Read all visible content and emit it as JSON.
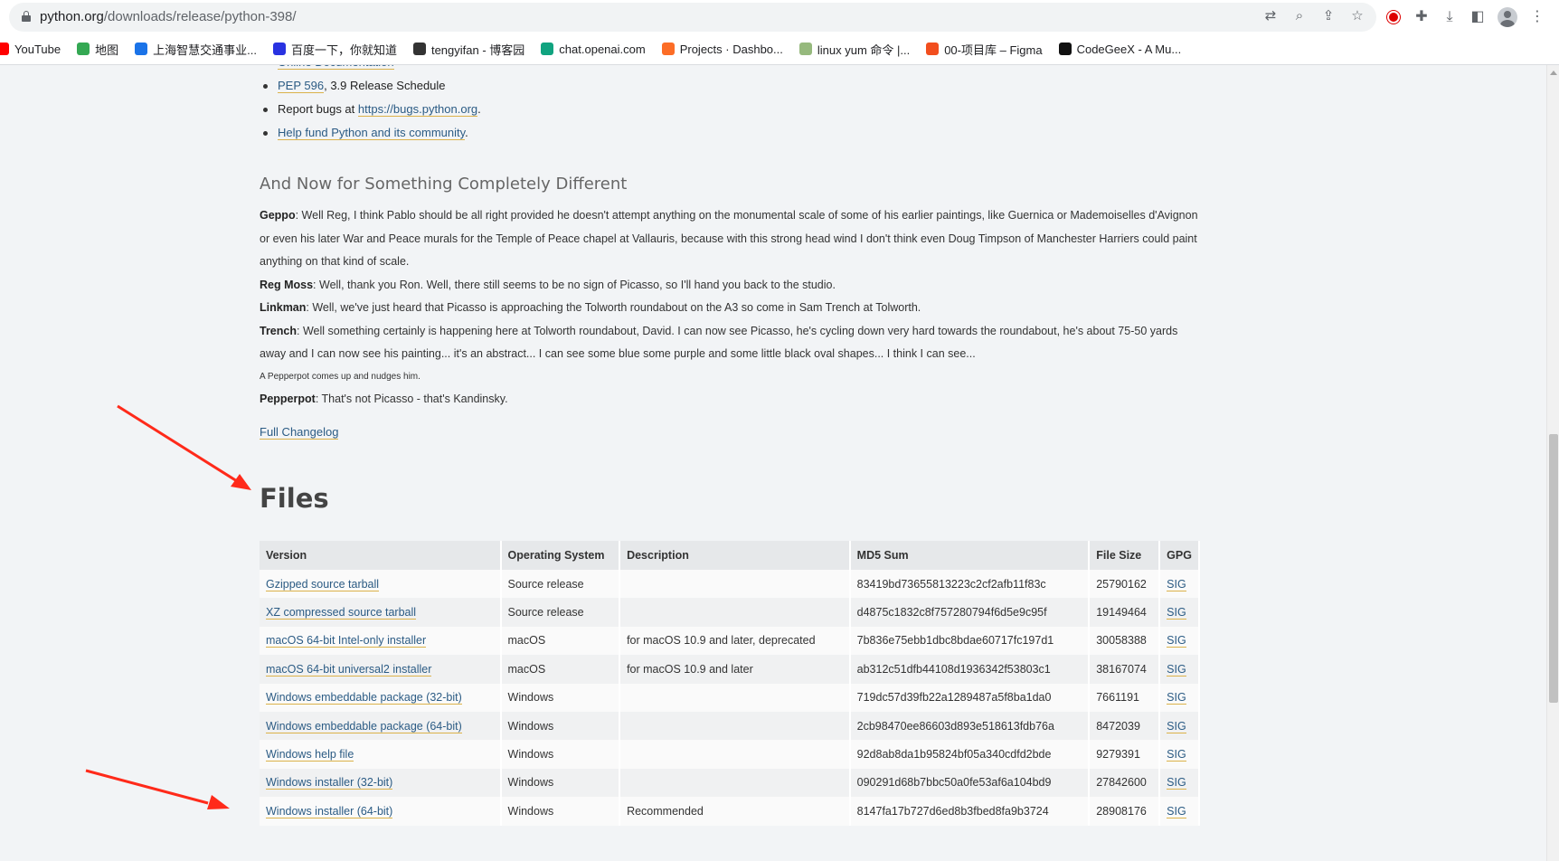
{
  "browser": {
    "url_host": "python.org",
    "url_path": "/downloads/release/python-398/",
    "bookmarks": [
      {
        "label": "YouTube",
        "icon": "youtube-icon",
        "color": "#ff0000"
      },
      {
        "label": "地图",
        "icon": "maps-icon",
        "color": "#34a853"
      },
      {
        "label": "上海智慧交通事业...",
        "icon": "bookmark-icon",
        "color": "#1a73e8"
      },
      {
        "label": "百度一下，你就知道",
        "icon": "baidu-icon",
        "color": "#2932e1"
      },
      {
        "label": "tengyifan - 博客园",
        "icon": "cnblogs-icon",
        "color": "#333333"
      },
      {
        "label": "chat.openai.com",
        "icon": "openai-icon",
        "color": "#10a37f"
      },
      {
        "label": "Projects · Dashbo...",
        "icon": "gitlab-icon",
        "color": "#fc6d26"
      },
      {
        "label": "linux yum 命令 |...",
        "icon": "runoob-icon",
        "color": "#96b97d"
      },
      {
        "label": "00-项目库 – Figma",
        "icon": "figma-icon",
        "color": "#f24e1e"
      },
      {
        "label": "CodeGeeX - A Mu...",
        "icon": "codegeex-icon",
        "color": "#111111"
      }
    ]
  },
  "links": [
    {
      "pre": "",
      "link": "Online Documentation",
      "post": ""
    },
    {
      "pre": "",
      "link": "PEP 596",
      "post": ", 3.9 Release Schedule"
    },
    {
      "pre": "Report bugs at ",
      "link": "https://bugs.python.org",
      "post": "."
    },
    {
      "pre": "",
      "link": "Help fund Python and its community",
      "post": "."
    }
  ],
  "section_heading": "And Now for Something Completely Different",
  "dialog": [
    {
      "speaker": "Geppo",
      "text": ": Well Reg, I think Pablo should be all right provided he doesn't attempt anything on the monumental scale of some of his earlier paintings, like Guernica or Mademoiselles d'Avignon or even his later War and Peace murals for the Temple of Peace chapel at Vallauris, because with this strong head wind I don't think even Doug Timpson of Manchester Harriers could paint anything on that kind of scale."
    },
    {
      "speaker": "Reg Moss",
      "text": ": Well, thank you Ron. Well, there still seems to be no sign of Picasso, so I'll hand you back to the studio."
    },
    {
      "speaker": "Linkman",
      "text": ": Well, we've just heard that Picasso is approaching the Tolworth roundabout on the A3 so come in Sam Trench at Tolworth."
    },
    {
      "speaker": "Trench",
      "text": ": Well something certainly is happening here at Tolworth roundabout, David. I can now see Picasso, he's cycling down very hard towards the roundabout, he's about 75-50 yards away and I can now see his painting... it's an abstract... I can see some blue some purple and some little black oval shapes... I think I can see..."
    },
    {
      "stage": "A Pepperpot comes up and nudges him."
    },
    {
      "speaker": "Pepperpot",
      "text": ": That's not Picasso - that's Kandinsky."
    }
  ],
  "changelog_label": "Full Changelog",
  "files_heading": "Files",
  "files_table": {
    "headers": [
      "Version",
      "Operating System",
      "Description",
      "MD5 Sum",
      "File Size",
      "GPG"
    ],
    "rows": [
      {
        "version": "Gzipped source tarball",
        "os": "Source release",
        "desc": "",
        "md5": "83419bd73655813223c2cf2afb11f83c",
        "size": "25790162",
        "gpg": "SIG"
      },
      {
        "version": "XZ compressed source tarball",
        "os": "Source release",
        "desc": "",
        "md5": "d4875c1832c8f757280794f6d5e9c95f",
        "size": "19149464",
        "gpg": "SIG"
      },
      {
        "version": "macOS 64-bit Intel-only installer",
        "os": "macOS",
        "desc": "for macOS 10.9 and later, deprecated",
        "md5": "7b836e75ebb1dbc8bdae60717fc197d1",
        "size": "30058388",
        "gpg": "SIG"
      },
      {
        "version": "macOS 64-bit universal2 installer",
        "os": "macOS",
        "desc": "for macOS 10.9 and later",
        "md5": "ab312c51dfb44108d1936342f53803c1",
        "size": "38167074",
        "gpg": "SIG"
      },
      {
        "version": "Windows embeddable package (32-bit)",
        "os": "Windows",
        "desc": "",
        "md5": "719dc57d39fb22a1289487a5f8ba1da0",
        "size": "7661191",
        "gpg": "SIG"
      },
      {
        "version": "Windows embeddable package (64-bit)",
        "os": "Windows",
        "desc": "",
        "md5": "2cb98470ee86603d893e518613fdb76a",
        "size": "8472039",
        "gpg": "SIG"
      },
      {
        "version": "Windows help file",
        "os": "Windows",
        "desc": "",
        "md5": "92d8ab8da1b95824bf05a340cdfd2bde",
        "size": "9279391",
        "gpg": "SIG"
      },
      {
        "version": "Windows installer (32-bit)",
        "os": "Windows",
        "desc": "",
        "md5": "090291d68b7bbc50a0fe53af6a104bd9",
        "size": "27842600",
        "gpg": "SIG"
      },
      {
        "version": "Windows installer (64-bit)",
        "os": "Windows",
        "desc": "Recommended",
        "md5": "8147fa17b727d6ed8b3fbed8fa9b3724",
        "size": "28908176",
        "gpg": "SIG"
      }
    ]
  },
  "annotation_color": "#ff2a1a"
}
